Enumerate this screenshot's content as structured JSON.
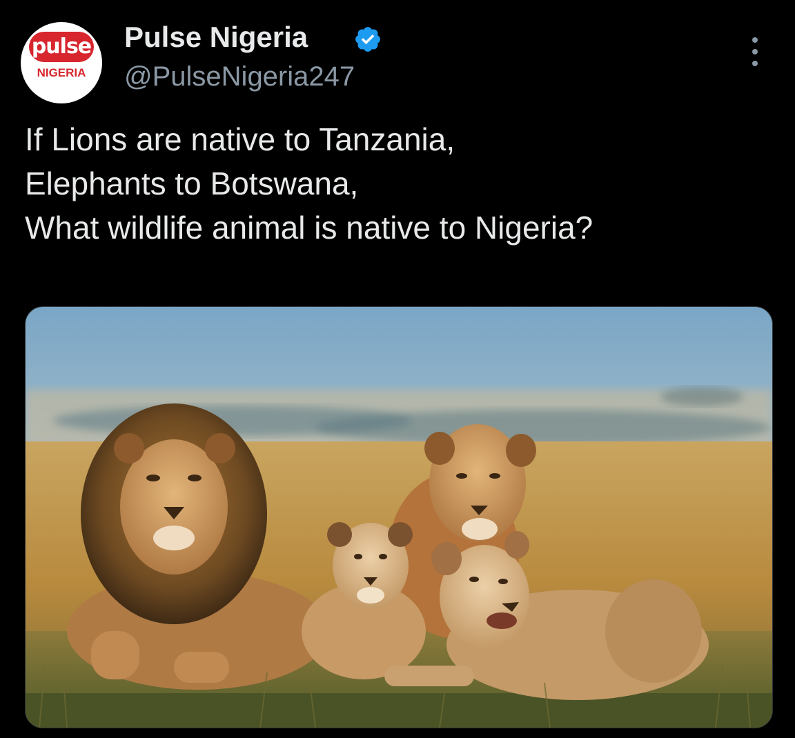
{
  "account": {
    "display_name": "Pulse Nigeria",
    "handle": "@PulseNigeria247",
    "verified": true,
    "avatar": {
      "logo_text": "pulse",
      "sub_text": "NIGERIA",
      "brand_color": "#d7262e"
    }
  },
  "tweet": {
    "lines": [
      "If Lions are native to Tanzania,",
      "Elephants to Botswana,",
      "What wildlife animal is native to Nigeria?"
    ]
  },
  "media": {
    "subject": "lion-pride-photo"
  },
  "icons": {
    "verified": "verified-badge-icon",
    "more": "more-options-icon"
  },
  "colors": {
    "background": "#000000",
    "text": "#e7e9ea",
    "secondary_text": "#8b98a5",
    "verified_blue": "#1d9bf0"
  }
}
